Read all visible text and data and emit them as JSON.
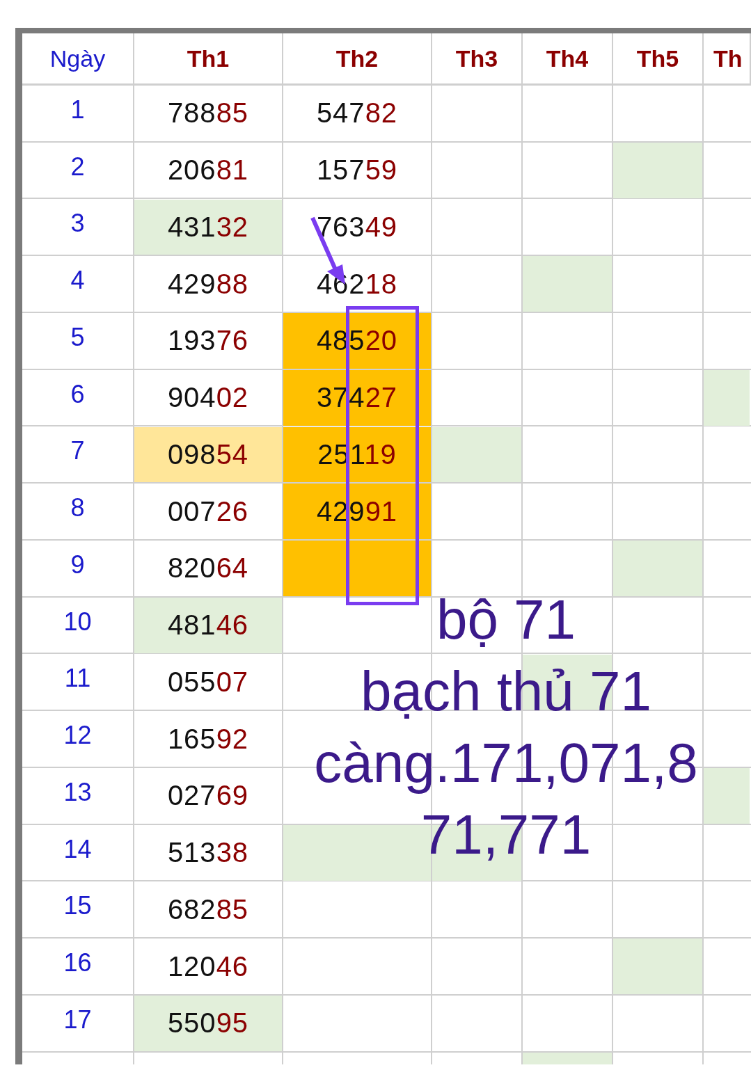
{
  "table": {
    "columns": [
      {
        "label": "Ngày",
        "kind": "day"
      },
      {
        "label": "Th1",
        "kind": "month"
      },
      {
        "label": "Th2",
        "kind": "month"
      },
      {
        "label": "Th3",
        "kind": "month"
      },
      {
        "label": "Th4",
        "kind": "month"
      },
      {
        "label": "Th5",
        "kind": "month"
      },
      {
        "label": "Th",
        "kind": "month"
      }
    ],
    "rows": [
      {
        "cells": [
          {
            "value": "1"
          },
          {
            "value": "78885"
          },
          {
            "value": "54782"
          },
          {},
          {},
          {},
          {}
        ]
      },
      {
        "cells": [
          {
            "value": "2"
          },
          {
            "value": "20681"
          },
          {
            "value": "15759"
          },
          {},
          {},
          {
            "color": "#e2efda"
          },
          {}
        ]
      },
      {
        "cells": [
          {
            "value": "3"
          },
          {
            "value": "43132",
            "color": "#e2efda"
          },
          {
            "value": "76349"
          },
          {},
          {},
          {},
          {}
        ]
      },
      {
        "cells": [
          {
            "value": "4"
          },
          {
            "value": "42988"
          },
          {
            "value": "46218"
          },
          {},
          {
            "color": "#e2efda"
          },
          {},
          {}
        ]
      },
      {
        "cells": [
          {
            "value": "5"
          },
          {
            "value": "19376"
          },
          {
            "value": "48520",
            "color": "#ffc000"
          },
          {},
          {},
          {},
          {}
        ]
      },
      {
        "cells": [
          {
            "value": "6"
          },
          {
            "value": "90402"
          },
          {
            "value": "37427",
            "color": "#ffc000"
          },
          {},
          {},
          {},
          {
            "color": "#e2efda"
          }
        ]
      },
      {
        "cells": [
          {
            "value": "7"
          },
          {
            "value": "09854",
            "color": "#ffe699"
          },
          {
            "value": "25119",
            "color": "#ffc000"
          },
          {
            "color": "#e2efda"
          },
          {},
          {},
          {}
        ]
      },
      {
        "cells": [
          {
            "value": "8"
          },
          {
            "value": "00726"
          },
          {
            "value": "42991",
            "color": "#ffc000"
          },
          {},
          {},
          {},
          {}
        ]
      },
      {
        "cells": [
          {
            "value": "9"
          },
          {
            "value": "82064"
          },
          {
            "color": "#ffc000"
          },
          {},
          {},
          {
            "color": "#e2efda"
          },
          {}
        ]
      },
      {
        "cells": [
          {
            "value": "10"
          },
          {
            "value": "48146",
            "color": "#e2efda"
          },
          {},
          {},
          {},
          {},
          {}
        ]
      },
      {
        "cells": [
          {
            "value": "11"
          },
          {
            "value": "05507"
          },
          {},
          {},
          {
            "color": "#e2efda"
          },
          {},
          {}
        ]
      },
      {
        "cells": [
          {
            "value": "12"
          },
          {
            "value": "16592"
          },
          {},
          {},
          {},
          {},
          {}
        ]
      },
      {
        "cells": [
          {
            "value": "13"
          },
          {
            "value": "02769"
          },
          {},
          {},
          {},
          {},
          {
            "color": "#e2efda"
          }
        ]
      },
      {
        "cells": [
          {
            "value": "14"
          },
          {
            "value": "51338"
          },
          {
            "color": "#e2efda"
          },
          {
            "color": "#e2efda"
          },
          {},
          {},
          {}
        ]
      },
      {
        "cells": [
          {
            "value": "15"
          },
          {
            "value": "68285"
          },
          {},
          {},
          {},
          {},
          {}
        ]
      },
      {
        "cells": [
          {
            "value": "16"
          },
          {
            "value": "12046"
          },
          {},
          {},
          {},
          {
            "color": "#e2efda"
          },
          {}
        ]
      },
      {
        "cells": [
          {
            "value": "17"
          },
          {
            "value": "55095",
            "color": "#e2efda"
          },
          {},
          {},
          {},
          {},
          {}
        ]
      },
      {
        "cells": [
          {},
          {},
          {},
          {},
          {
            "color": "#e2efda"
          },
          {},
          {}
        ]
      }
    ]
  },
  "annotation": {
    "lines": [
      "bộ 71",
      "bạch thủ 71",
      "càng.171,071,8",
      "71,771"
    ]
  }
}
